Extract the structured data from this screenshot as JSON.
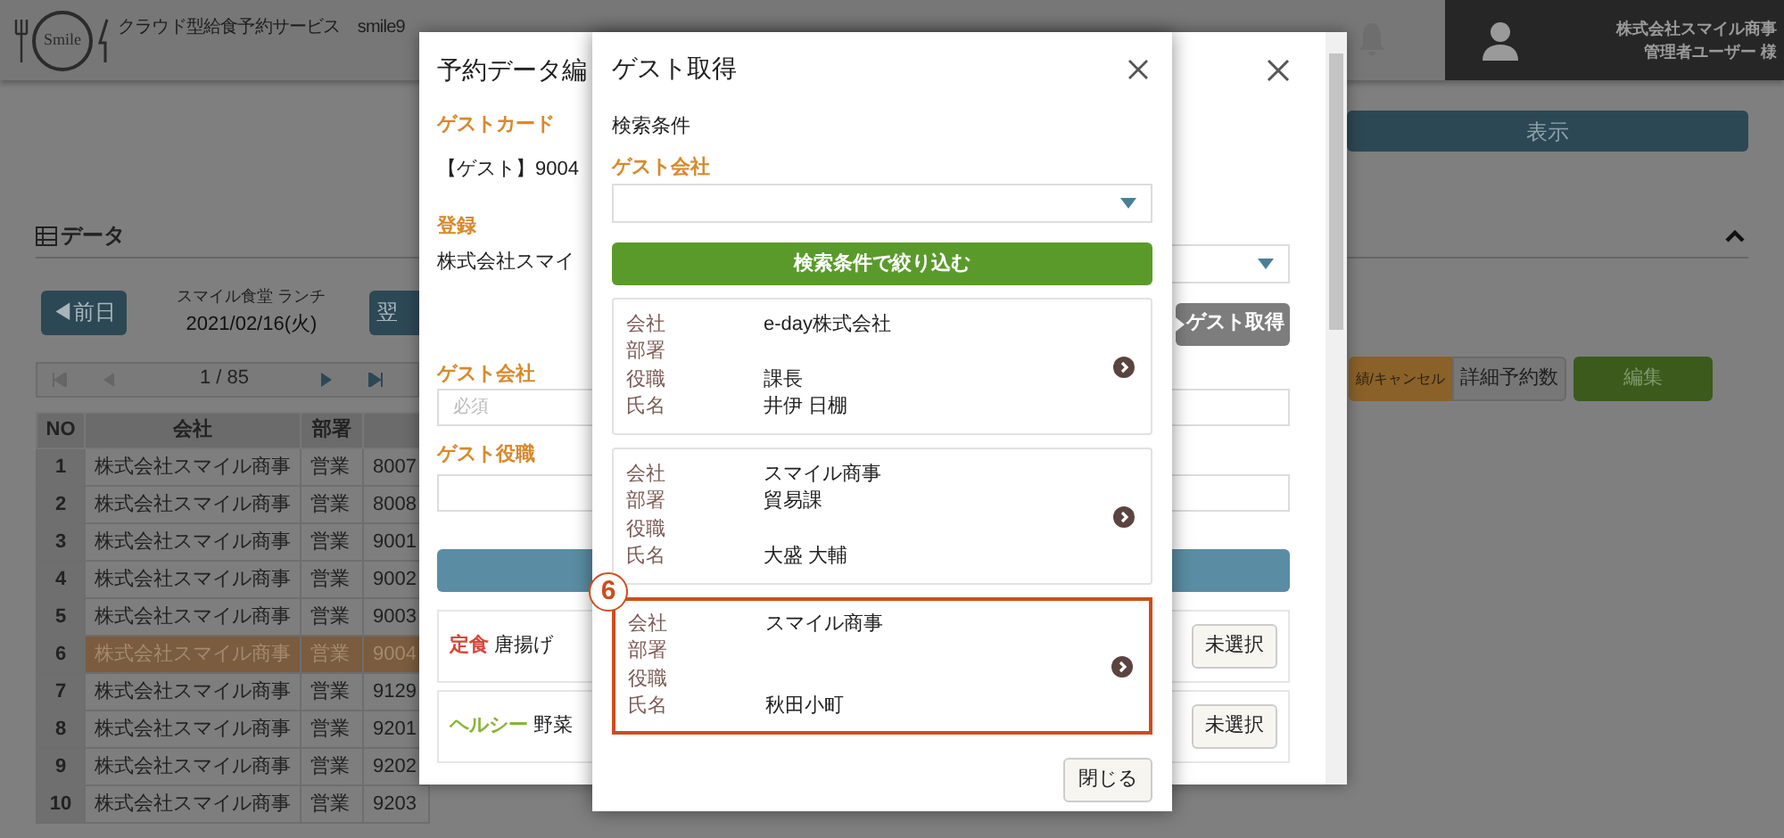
{
  "header": {
    "logo_text": "Smile",
    "title": "クラウド型給食予約サービス　smile9",
    "user_company": "株式会社スマイル商事",
    "user_role": "管理者ユーザー 様"
  },
  "toolbar": {
    "show_button": "表示"
  },
  "data_panel": {
    "heading": "データ",
    "expanded": true,
    "prev_button": "◀前日",
    "cafeteria": "スマイル食堂 ランチ",
    "date": "2021/02/16(火)",
    "next_button": "翌",
    "pager": "1 / 85",
    "actions": [
      {
        "label": "績/キャンセル",
        "kind": "orange"
      },
      {
        "label": "詳細予約数",
        "kind": "plain"
      },
      {
        "label": "編集",
        "kind": "green"
      }
    ]
  },
  "table": {
    "columns": [
      "NO",
      "会社",
      "部署"
    ],
    "rows": [
      {
        "cells": [
          "1",
          "株式会社スマイル商事",
          "営業",
          "8007"
        ],
        "selected": false
      },
      {
        "cells": [
          "2",
          "株式会社スマイル商事",
          "営業",
          "8008"
        ],
        "selected": false
      },
      {
        "cells": [
          "3",
          "株式会社スマイル商事",
          "営業",
          "9001"
        ],
        "selected": false
      },
      {
        "cells": [
          "4",
          "株式会社スマイル商事",
          "営業",
          "9002"
        ],
        "selected": false
      },
      {
        "cells": [
          "5",
          "株式会社スマイル商事",
          "営業",
          "9003"
        ],
        "selected": false
      },
      {
        "cells": [
          "6",
          "株式会社スマイル商事",
          "営業",
          "9004"
        ],
        "selected": true
      },
      {
        "cells": [
          "7",
          "株式会社スマイル商事",
          "営業",
          "9129"
        ],
        "selected": false
      },
      {
        "cells": [
          "8",
          "株式会社スマイル商事",
          "営業",
          "9201"
        ],
        "selected": false
      },
      {
        "cells": [
          "9",
          "株式会社スマイル商事",
          "営業",
          "9202"
        ],
        "selected": false
      },
      {
        "cells": [
          "10",
          "株式会社スマイル商事",
          "営業",
          "9203"
        ],
        "selected": false
      }
    ]
  },
  "edit_dialog": {
    "title": "予約データ編",
    "guest_card_label": "ゲストカード",
    "guest_card_value": "【ゲスト】9004",
    "registration_label": "登録",
    "registration_value": "株式会社スマイ",
    "guest_fetch_button": "ゲスト取得",
    "guest_company_label": "ゲスト会社",
    "guest_company_placeholder": "必須",
    "guest_title_label": "ゲスト役職",
    "menus": [
      {
        "category": "定食",
        "color": "#d9463a",
        "name": "唐揚げ",
        "button": "未選択"
      },
      {
        "category": "ヘルシー",
        "color": "#8ab437",
        "name": "野菜",
        "button": "未選択"
      }
    ]
  },
  "guest_dialog": {
    "title": "ゲスト取得",
    "search_heading": "検索条件",
    "company_label": "ゲスト会社",
    "filter_button": "検索条件で絞り込む",
    "callout": "6",
    "close_button": "閉じる",
    "results": [
      {
        "selected": false,
        "fields": [
          {
            "label": "会社",
            "value": "e-day株式会社"
          },
          {
            "label": "部署"
          },
          {
            "label": "役職",
            "value": "課長"
          },
          {
            "label": "氏名",
            "value": "井伊 日棚"
          }
        ]
      },
      {
        "selected": false,
        "fields": [
          {
            "label": "会社",
            "value": "スマイル商事"
          },
          {
            "label": "部署",
            "value": "貿易課"
          },
          {
            "label": "役職"
          },
          {
            "label": "氏名",
            "value": "大盛 大輔"
          }
        ]
      },
      {
        "selected": true,
        "fields": [
          {
            "label": "会社",
            "value": "スマイル商事"
          },
          {
            "label": "部署"
          },
          {
            "label": "役職"
          },
          {
            "label": "氏名",
            "value": "秋田小町"
          }
        ]
      }
    ]
  }
}
